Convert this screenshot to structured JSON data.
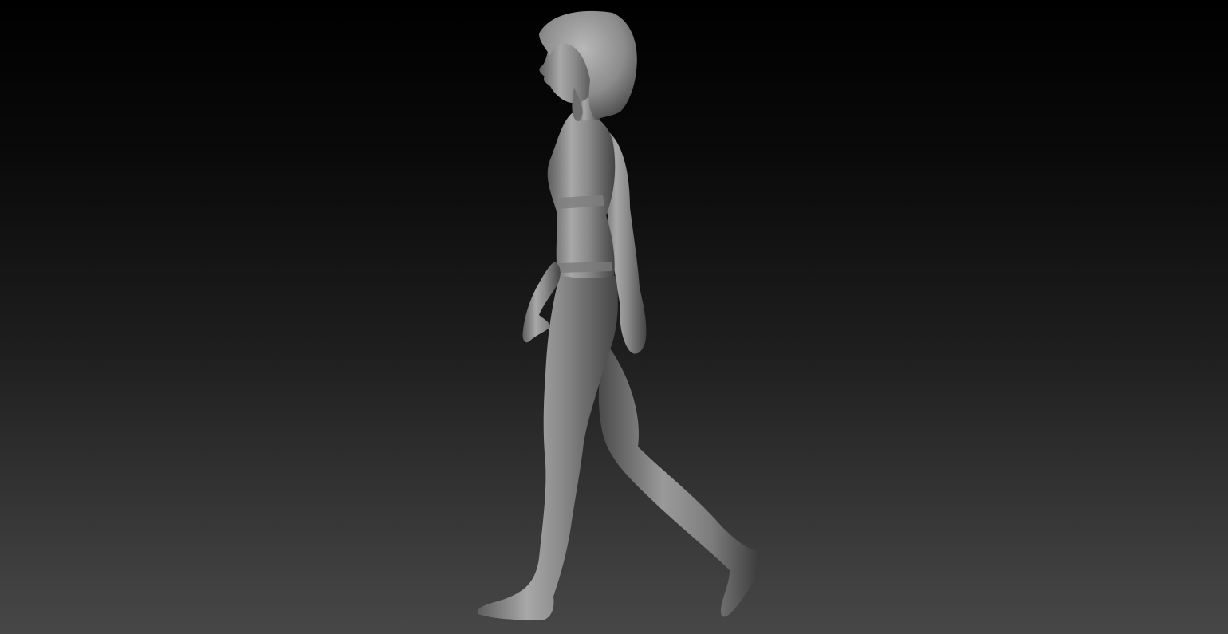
{
  "scene": {
    "background": {
      "top_color": "#000000",
      "bottom_color": "#474747"
    },
    "model": {
      "subject": "walking-female-figure",
      "material_color": "#8e8e8e",
      "highlight_color": "#b4b4b4",
      "shadow_color": "#3c3c3c"
    }
  }
}
